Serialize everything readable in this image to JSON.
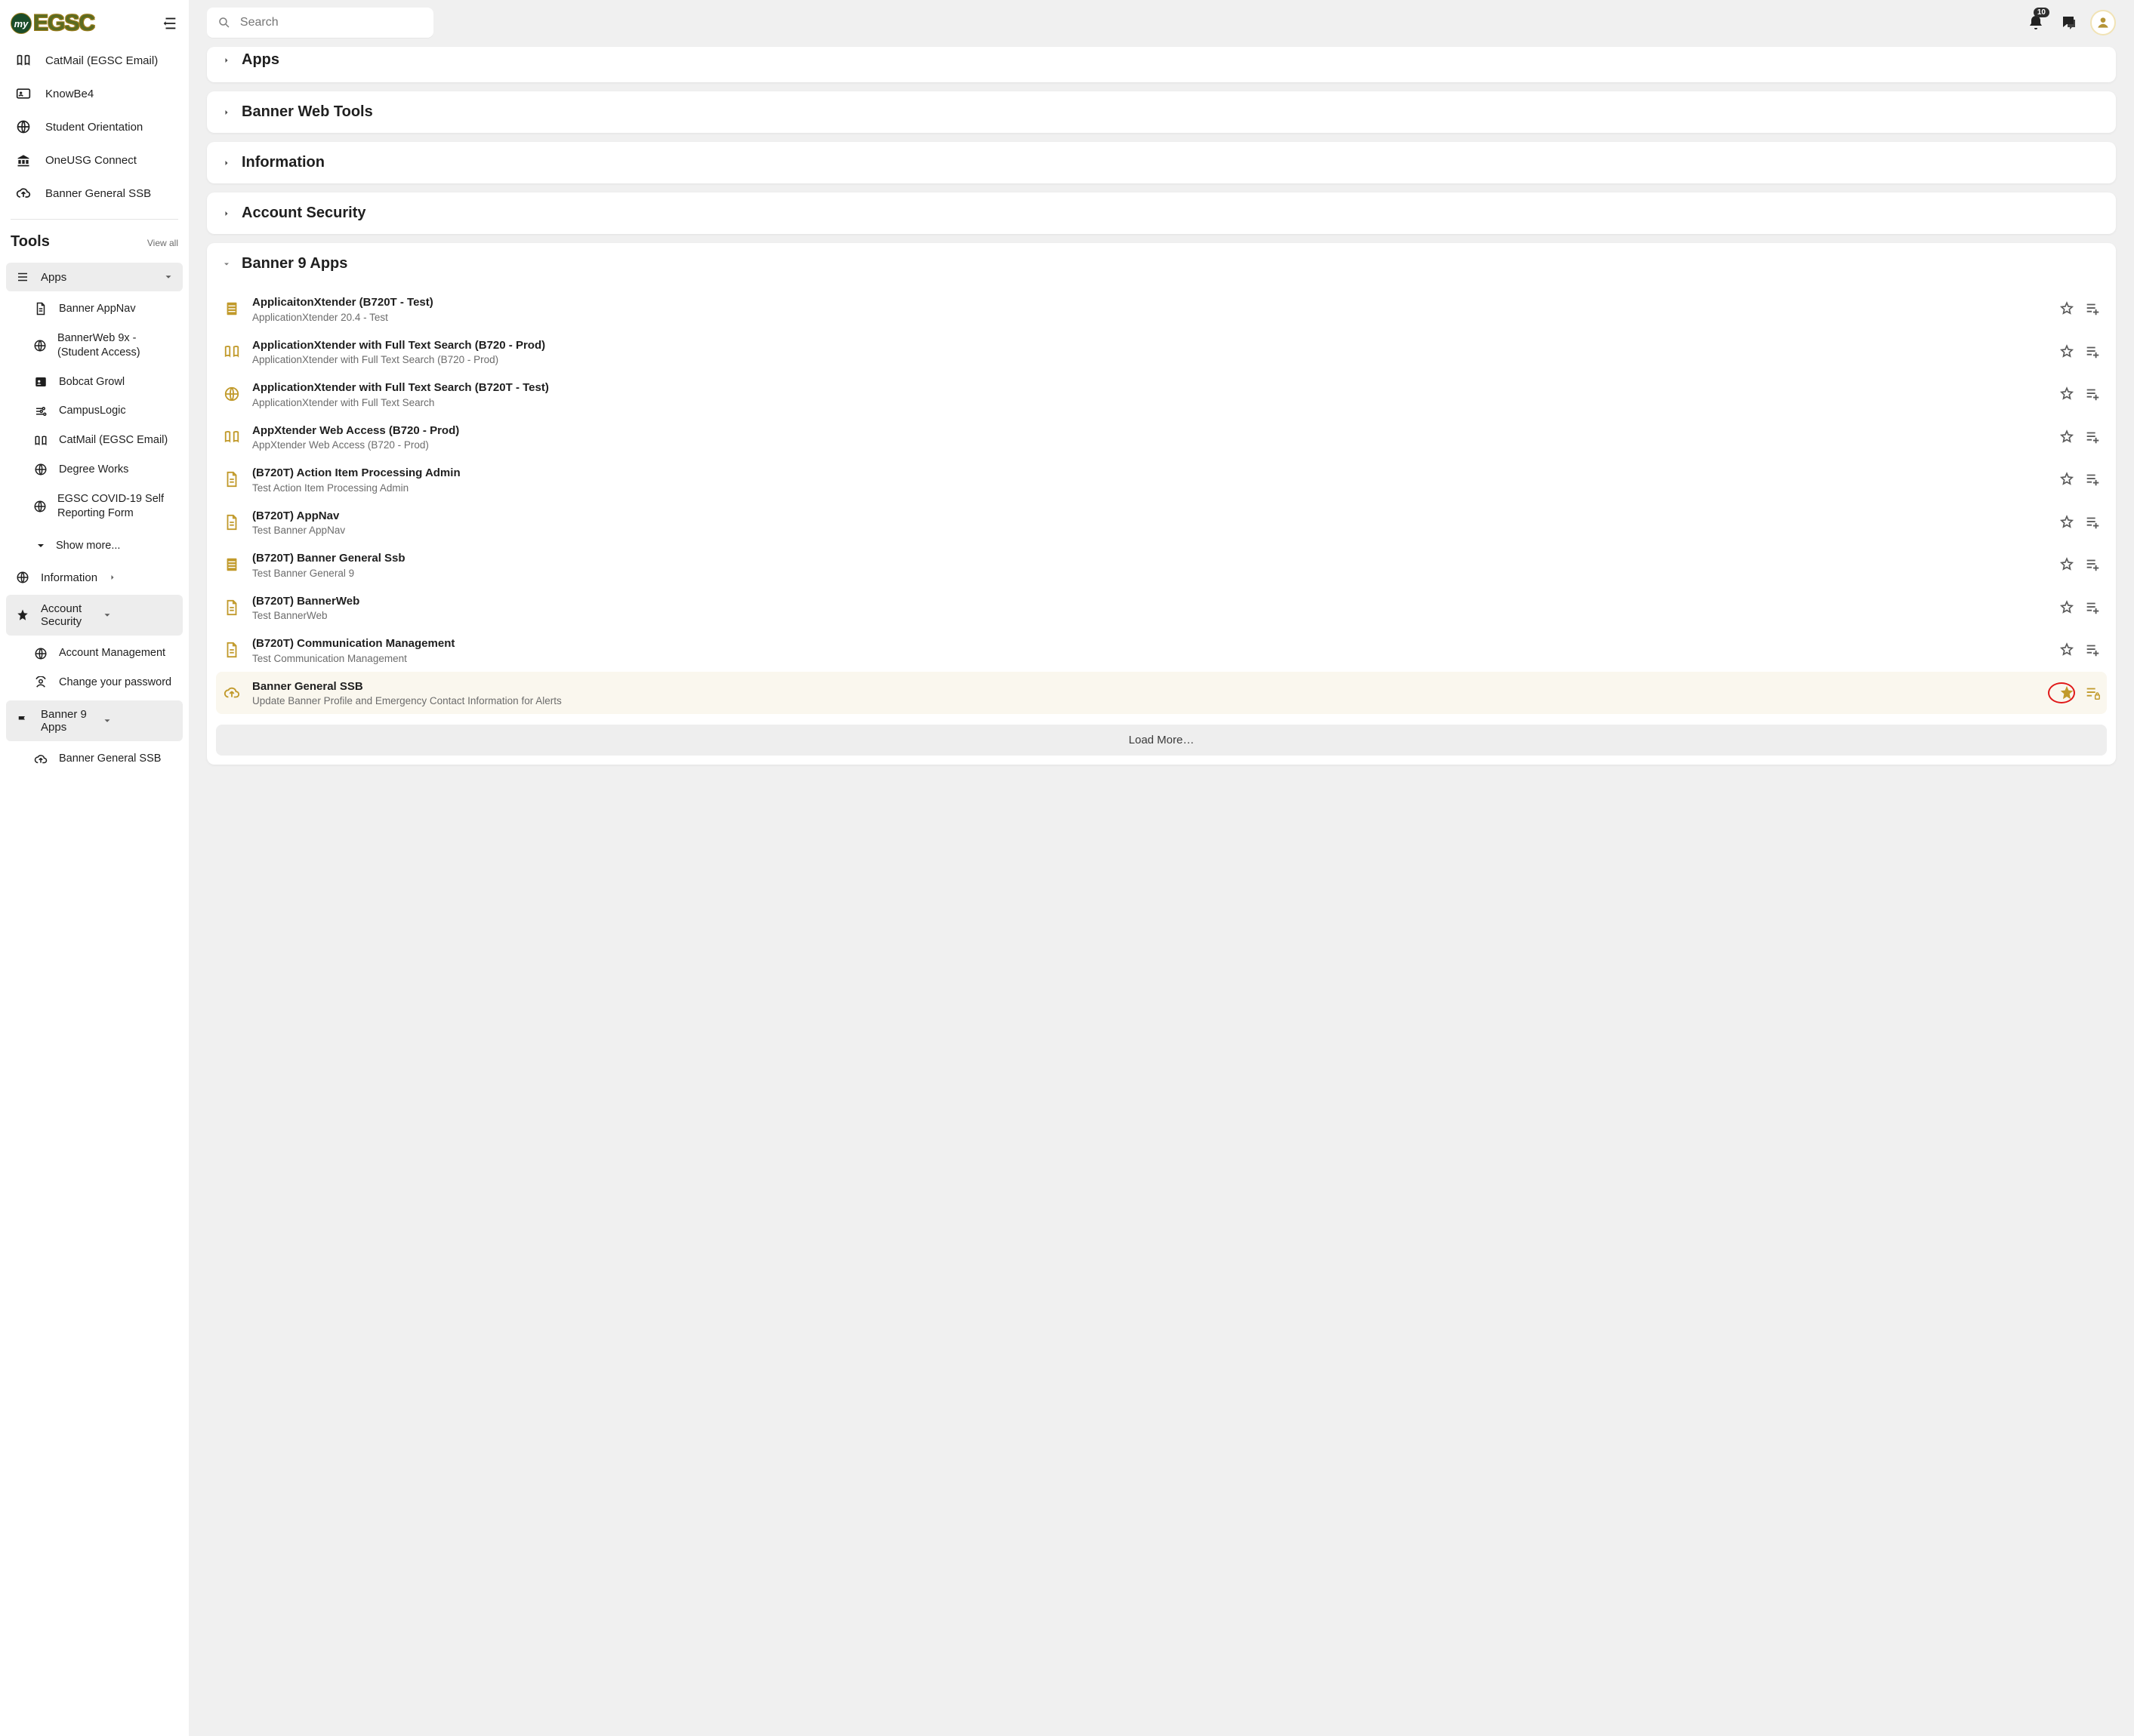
{
  "brand": {
    "circle_text": "my",
    "text": "EGSC"
  },
  "search": {
    "placeholder": "Search"
  },
  "topbar": {
    "notification_count": "10"
  },
  "sidebar": {
    "quick_links": [
      {
        "name": "catmail",
        "icon": "book-open",
        "label": "CatMail (EGSC Email)"
      },
      {
        "name": "knowbe4",
        "icon": "id-card",
        "label": "KnowBe4"
      },
      {
        "name": "student-orientation",
        "icon": "globe",
        "label": "Student Orientation"
      },
      {
        "name": "oneusg-connect",
        "icon": "bank",
        "label": "OneUSG Connect"
      },
      {
        "name": "banner-general-ssb",
        "icon": "cloud-up",
        "label": "Banner General SSB"
      }
    ],
    "tools_header": {
      "title": "Tools",
      "view_all": "View all"
    },
    "sections": {
      "apps": {
        "label": "Apps"
      },
      "information": {
        "label": "Information"
      },
      "account_security": {
        "label": "Account Security"
      },
      "banner9": {
        "label": "Banner 9 Apps"
      }
    },
    "apps_items": [
      {
        "icon": "file",
        "label": "Banner AppNav"
      },
      {
        "icon": "globe",
        "label": "BannerWeb 9x - (Student Access)"
      },
      {
        "icon": "contact",
        "label": "Bobcat Growl"
      },
      {
        "icon": "sliders",
        "label": "CampusLogic"
      },
      {
        "icon": "book-open",
        "label": "CatMail (EGSC Email)"
      },
      {
        "icon": "globe",
        "label": "Degree Works"
      },
      {
        "icon": "globe",
        "label": "EGSC COVID-19 Self Reporting Form"
      }
    ],
    "show_more": "Show more...",
    "security_items": [
      {
        "icon": "globe",
        "label": "Account Management"
      },
      {
        "icon": "avatar-refresh",
        "label": "Change your password"
      }
    ],
    "banner9_items": [
      {
        "icon": "cloud-up",
        "label": "Banner General SSB"
      }
    ]
  },
  "main": {
    "sections": {
      "apps": "Apps",
      "banner_web_tools": "Banner Web Tools",
      "information": "Information",
      "account_security": "Account Security",
      "banner9": "Banner 9 Apps"
    },
    "banner9_entries": [
      {
        "icon": "sheet",
        "title": "ApplicaitonXtender (B720T - Test)",
        "sub": "ApplicationXtender 20.4 - Test",
        "starred": false,
        "highlight": false
      },
      {
        "icon": "book-open",
        "title": "ApplicationXtender with Full Text Search (B720 - Prod)",
        "sub": "ApplicationXtender with Full Text Search (B720 - Prod)",
        "starred": false,
        "highlight": false
      },
      {
        "icon": "globe",
        "title": "ApplicationXtender with Full Text Search (B720T - Test)",
        "sub": "ApplicationXtender with Full Text Search",
        "starred": false,
        "highlight": false
      },
      {
        "icon": "book-open",
        "title": "AppXtender Web Access (B720 - Prod)",
        "sub": "AppXtender Web Access (B720 - Prod)",
        "starred": false,
        "highlight": false
      },
      {
        "icon": "file",
        "title": "(B720T) Action Item Processing Admin",
        "sub": "Test Action Item Processing Admin",
        "starred": false,
        "highlight": false
      },
      {
        "icon": "file",
        "title": "(B720T) AppNav",
        "sub": "Test Banner AppNav",
        "starred": false,
        "highlight": false
      },
      {
        "icon": "sheet",
        "title": "(B720T) Banner General Ssb",
        "sub": "Test Banner General 9",
        "starred": false,
        "highlight": false
      },
      {
        "icon": "file",
        "title": "(B720T) BannerWeb",
        "sub": "Test BannerWeb",
        "starred": false,
        "highlight": false
      },
      {
        "icon": "file",
        "title": "(B720T) Communication Management",
        "sub": "Test Communication Management",
        "starred": false,
        "highlight": false
      },
      {
        "icon": "cloud-up",
        "title": "Banner General SSB",
        "sub": "Update Banner Profile and Emergency Contact Information for Alerts",
        "starred": true,
        "highlight": true
      }
    ],
    "load_more": "Load More…"
  }
}
